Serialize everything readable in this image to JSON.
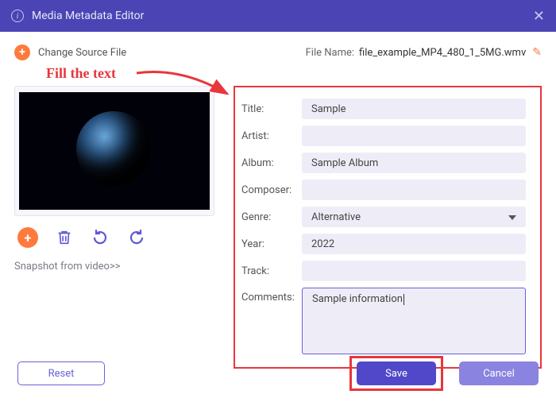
{
  "window": {
    "title": "Media Metadata Editor"
  },
  "header": {
    "change_source": "Change Source File",
    "file_name_label": "File Name:",
    "file_name_value": "file_example_MP4_480_1_5MG.wmv"
  },
  "annotation": {
    "fill_text": "Fill the text"
  },
  "preview": {
    "snapshot_link": "Snapshot from video>>"
  },
  "fields": {
    "labels": {
      "title": "Title:",
      "artist": "Artist:",
      "album": "Album:",
      "composer": "Composer:",
      "genre": "Genre:",
      "year": "Year:",
      "track": "Track:",
      "comments": "Comments:"
    },
    "values": {
      "title": "Sample",
      "artist": "",
      "album": "Sample Album",
      "composer": "",
      "genre": "Alternative",
      "year": "2022",
      "track": "",
      "comments": "Sample information"
    }
  },
  "buttons": {
    "reset": "Reset",
    "save": "Save",
    "cancel": "Cancel"
  }
}
